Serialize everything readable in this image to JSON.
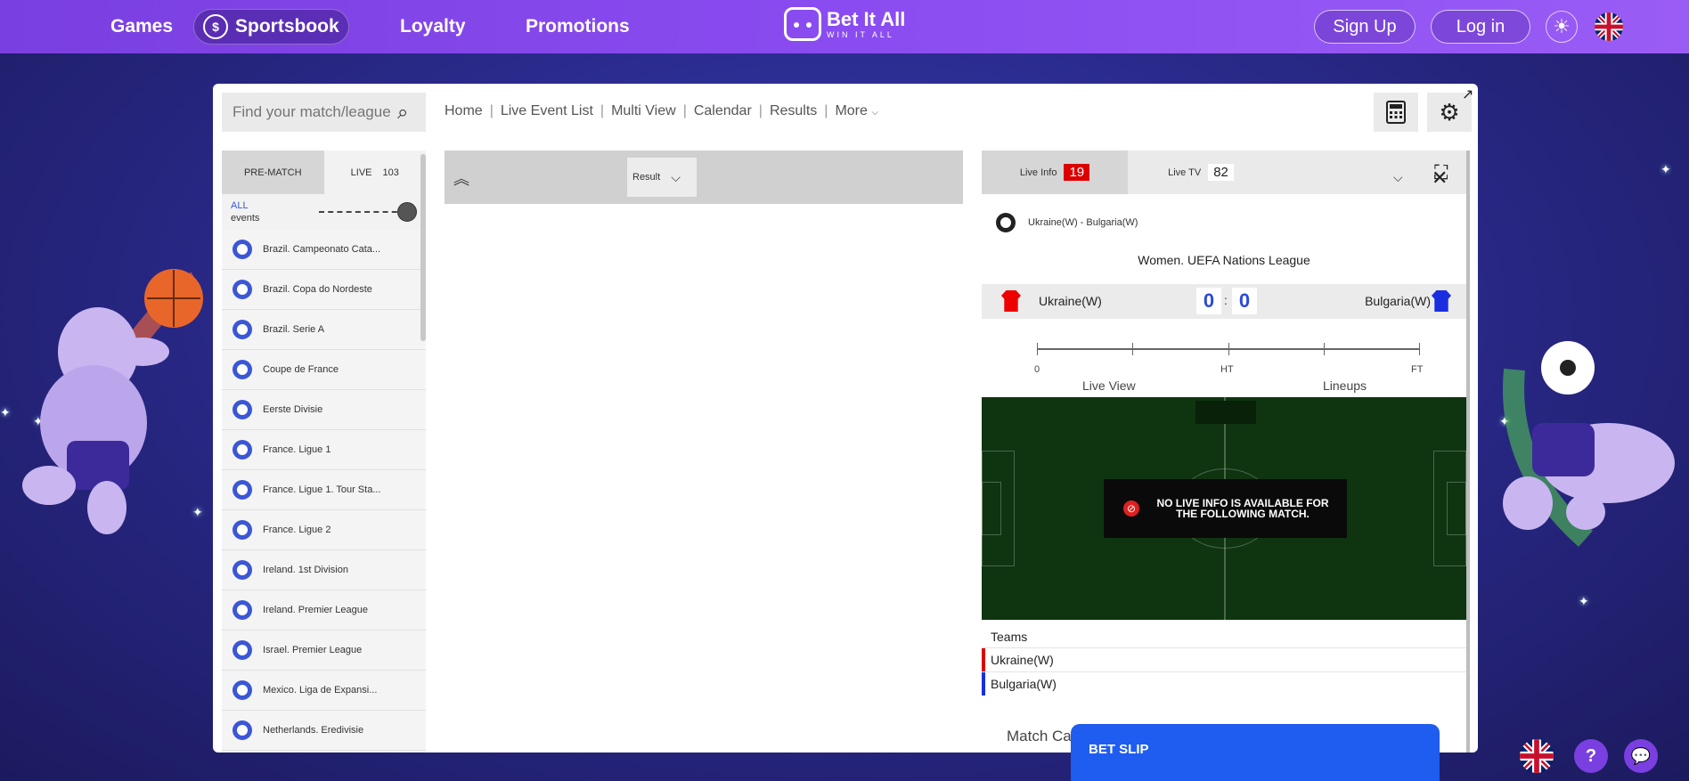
{
  "nav": {
    "games": "Games",
    "sportsbook": "Sportsbook",
    "loyalty": "Loyalty",
    "promotions": "Promotions",
    "logo_title": "Bet It All",
    "logo_tagline": "WIN IT ALL",
    "sign_up": "Sign Up",
    "log_in": "Log in"
  },
  "search": {
    "placeholder": "Find your match/league"
  },
  "breadcrumbs": [
    "Home",
    "Live Event List",
    "Multi View",
    "Calendar",
    "Results",
    "More"
  ],
  "sidebar": {
    "tab_prematch": "PRE-MATCH",
    "tab_live": "LIVE",
    "live_count": "103",
    "all_label": "ALL",
    "events_label": "events",
    "leagues": [
      "Brazil. Campeonato Cata...",
      "Brazil. Copa do Nordeste",
      "Brazil. Serie A",
      "Coupe de France",
      "Eerste Divisie",
      "France. Ligue 1",
      "France. Ligue 1. Tour Sta...",
      "France. Ligue 2",
      "Ireland. 1st Division",
      "Ireland. Premier League",
      "Israel. Premier League",
      "Mexico. Liga de Expansi...",
      "Netherlands. Eredivisie"
    ]
  },
  "center": {
    "result_select": "Result"
  },
  "live": {
    "tab_info": "Live Info",
    "info_count": "19",
    "tab_tv": "Live TV",
    "tv_count": "82",
    "match_name": "Ukraine(W) - Bulgaria(W)",
    "league": "Women. UEFA Nations League",
    "home_team": "Ukraine(W)",
    "away_team": "Bulgaria(W)",
    "home_score": "0",
    "away_score": "0",
    "colon": ":",
    "timeline_start": "0",
    "timeline_ht": "HT",
    "timeline_ft": "FT",
    "live_view": "Live View",
    "lineups": "Lineups",
    "no_info": "NO LIVE INFO IS AVAILABLE FOR THE FOLLOWING MATCH.",
    "teams_heading": "Teams",
    "team_rows": [
      "Ukraine(W)",
      "Bulgaria(W)"
    ],
    "match_cast": "Match Ca",
    "home_color": "#e00000",
    "away_color": "#1a2ee0"
  },
  "betslip": {
    "label": "BET SLIP"
  },
  "colors": {
    "nav_bg": "#8a4cf0",
    "accent_blue": "#3b57d6",
    "betslip_blue": "#1f5cf0"
  }
}
